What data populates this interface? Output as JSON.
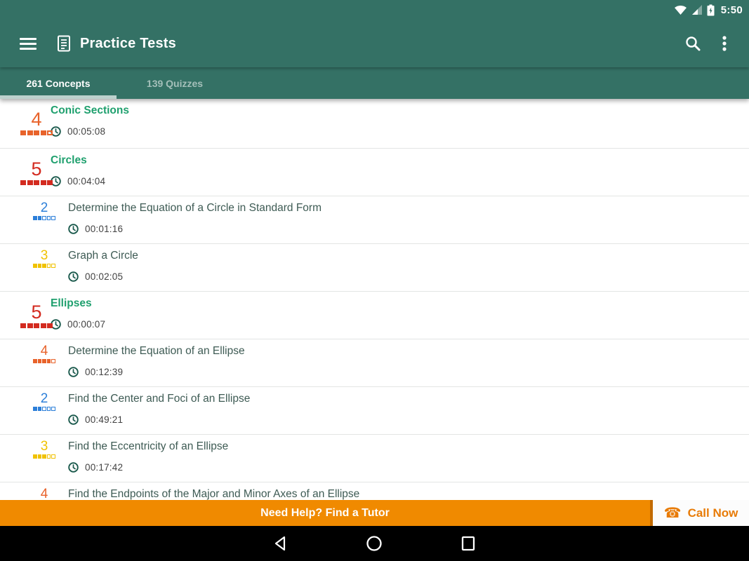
{
  "status_bar": {
    "time": "5:50",
    "icons": [
      "wifi-icon",
      "cellular-signal-icon",
      "battery-charging-icon"
    ]
  },
  "app_bar": {
    "title": "Practice Tests",
    "icons": [
      "menu-icon",
      "practice-tests-doc-icon",
      "search-icon",
      "overflow-menu-icon"
    ]
  },
  "tabs": [
    {
      "label": "261 Concepts",
      "active": true
    },
    {
      "label": "139 Quizzes",
      "active": false
    }
  ],
  "colors": {
    "app_bar_green": "#347165",
    "parent_title_green": "#1FA06E",
    "child_title": "#3E5B54",
    "banner_orange": "#F08A00",
    "call_now_orange": "#E87B07",
    "clock_green": "#1A594C",
    "difficulty": {
      "orange": "#E8632B",
      "red": "#D32B20",
      "blue": "#2C7FD9",
      "yellow": "#F0C200"
    }
  },
  "list": {
    "rows": [
      {
        "type": "category",
        "difficulty": 4,
        "color": "orange",
        "title": "Conic Sections",
        "time": "00:05:08"
      },
      {
        "type": "category",
        "difficulty": 5,
        "color": "red",
        "title": "Circles",
        "time": "00:04:04"
      },
      {
        "type": "concept",
        "difficulty": 2,
        "color": "blue",
        "title": "Determine the Equation of a Circle in Standard Form",
        "time": "00:01:16"
      },
      {
        "type": "concept",
        "difficulty": 3,
        "color": "yellow",
        "title": "Graph a Circle",
        "time": "00:02:05"
      },
      {
        "type": "category",
        "difficulty": 5,
        "color": "red",
        "title": "Ellipses",
        "time": "00:00:07"
      },
      {
        "type": "concept",
        "difficulty": 4,
        "color": "orange",
        "title": "Determine the Equation of an Ellipse",
        "time": "00:12:39"
      },
      {
        "type": "concept",
        "difficulty": 2,
        "color": "blue",
        "title": "Find the Center and Foci of an Ellipse",
        "time": "00:49:21"
      },
      {
        "type": "concept",
        "difficulty": 3,
        "color": "yellow",
        "title": "Find the Eccentricity of an Ellipse",
        "time": "00:17:42"
      },
      {
        "type": "concept",
        "difficulty": 4,
        "color": "orange",
        "title": "Find the Endpoints of the Major and Minor Axes of an Ellipse"
      }
    ]
  },
  "banner": {
    "message": "Need Help? Find a Tutor",
    "call_button": "Call Now",
    "phone_icon": "phone-icon"
  },
  "nav_bar": {
    "icons": [
      "back-icon",
      "home-icon",
      "recents-icon"
    ]
  }
}
